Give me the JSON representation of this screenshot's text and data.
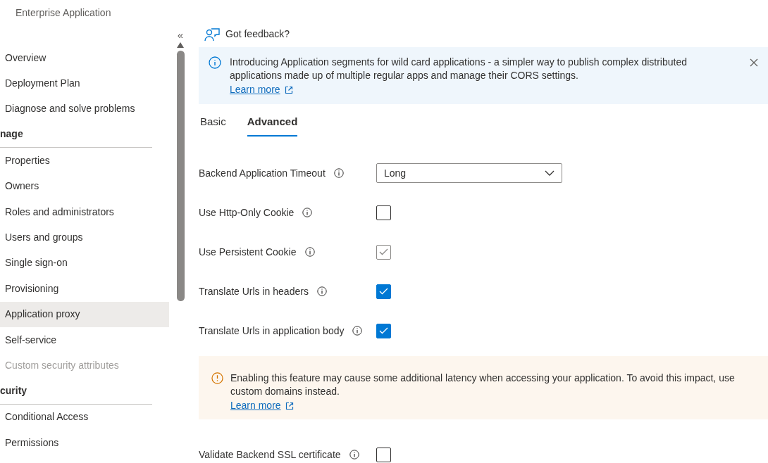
{
  "header": {
    "subtitle": "Enterprise Application"
  },
  "sidebar": {
    "collapse_glyph": "«",
    "groups": [
      {
        "items": [
          {
            "label": "Overview",
            "selected": false,
            "disabled": false
          },
          {
            "label": "Deployment Plan",
            "selected": false,
            "disabled": false
          },
          {
            "label": "Diagnose and solve problems",
            "selected": false,
            "disabled": false
          }
        ]
      },
      {
        "heading": "nage",
        "items": [
          {
            "label": "Properties",
            "selected": false,
            "disabled": false
          },
          {
            "label": "Owners",
            "selected": false,
            "disabled": false
          },
          {
            "label": "Roles and administrators",
            "selected": false,
            "disabled": false
          },
          {
            "label": "Users and groups",
            "selected": false,
            "disabled": false
          },
          {
            "label": "Single sign-on",
            "selected": false,
            "disabled": false
          },
          {
            "label": "Provisioning",
            "selected": false,
            "disabled": false
          },
          {
            "label": "Application proxy",
            "selected": true,
            "disabled": false
          },
          {
            "label": "Self-service",
            "selected": false,
            "disabled": false
          },
          {
            "label": "Custom security attributes",
            "selected": false,
            "disabled": true
          }
        ]
      },
      {
        "heading": "curity",
        "items": [
          {
            "label": "Conditional Access",
            "selected": false,
            "disabled": false
          },
          {
            "label": "Permissions",
            "selected": false,
            "disabled": false
          }
        ]
      }
    ]
  },
  "feedback": {
    "label": "Got feedback?"
  },
  "info_banner": {
    "text": "Introducing Application segments for wild card applications - a simpler way to publish complex distributed applications made up of multiple regular apps and manage their CORS settings.",
    "link": "Learn more"
  },
  "tabs": [
    {
      "label": "Basic",
      "selected": false
    },
    {
      "label": "Advanced",
      "selected": true
    }
  ],
  "settings": [
    {
      "kind": "dropdown",
      "label": "Backend Application Timeout",
      "value": "Long"
    },
    {
      "kind": "checkbox",
      "label": "Use Http-Only Cookie",
      "checked": false,
      "disabled": false
    },
    {
      "kind": "checkbox",
      "label": "Use Persistent Cookie",
      "checked": true,
      "disabled": true
    },
    {
      "kind": "checkbox",
      "label": "Translate Urls in headers",
      "checked": true,
      "disabled": false
    },
    {
      "kind": "checkbox",
      "label": "Translate Urls in application body",
      "checked": true,
      "disabled": false
    },
    {
      "kind": "notice",
      "text": "Enabling this feature may cause some additional latency when accessing your application. To avoid this impact, use custom domains instead.",
      "link": "Learn more"
    },
    {
      "kind": "checkbox",
      "label": "Validate Backend SSL certificate",
      "checked": false,
      "disabled": false
    }
  ]
}
